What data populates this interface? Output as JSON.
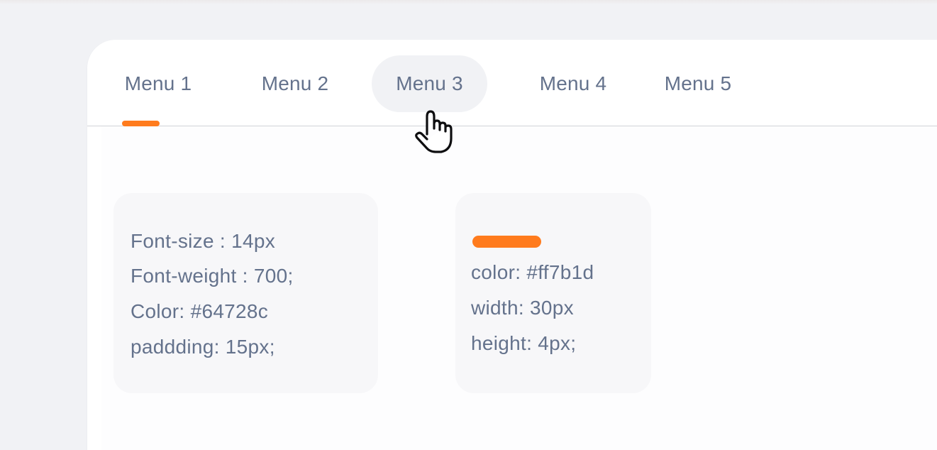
{
  "tabs": {
    "items": [
      {
        "label": "Menu 1"
      },
      {
        "label": "Menu 2"
      },
      {
        "label": "Menu 3"
      },
      {
        "label": "Menu 4"
      },
      {
        "label": "Menu 5"
      }
    ],
    "active_index": 0,
    "hover_index": 2
  },
  "cards": {
    "text_spec": {
      "lines": [
        "Font-size : 14px",
        "Font-weight : 700;",
        "Color: #64728c",
        "paddding: 15px;"
      ]
    },
    "indicator_spec": {
      "lines": [
        "color: #ff7b1d",
        "width: 30px",
        "height: 4px;"
      ]
    }
  },
  "colors": {
    "text": "#64728c",
    "accent": "#ff7b1d",
    "background": "#f1f2f5",
    "panel": "#ffffff",
    "hover": "#f1f2f5"
  },
  "icons": {
    "cursor": "hand-pointer-icon"
  }
}
